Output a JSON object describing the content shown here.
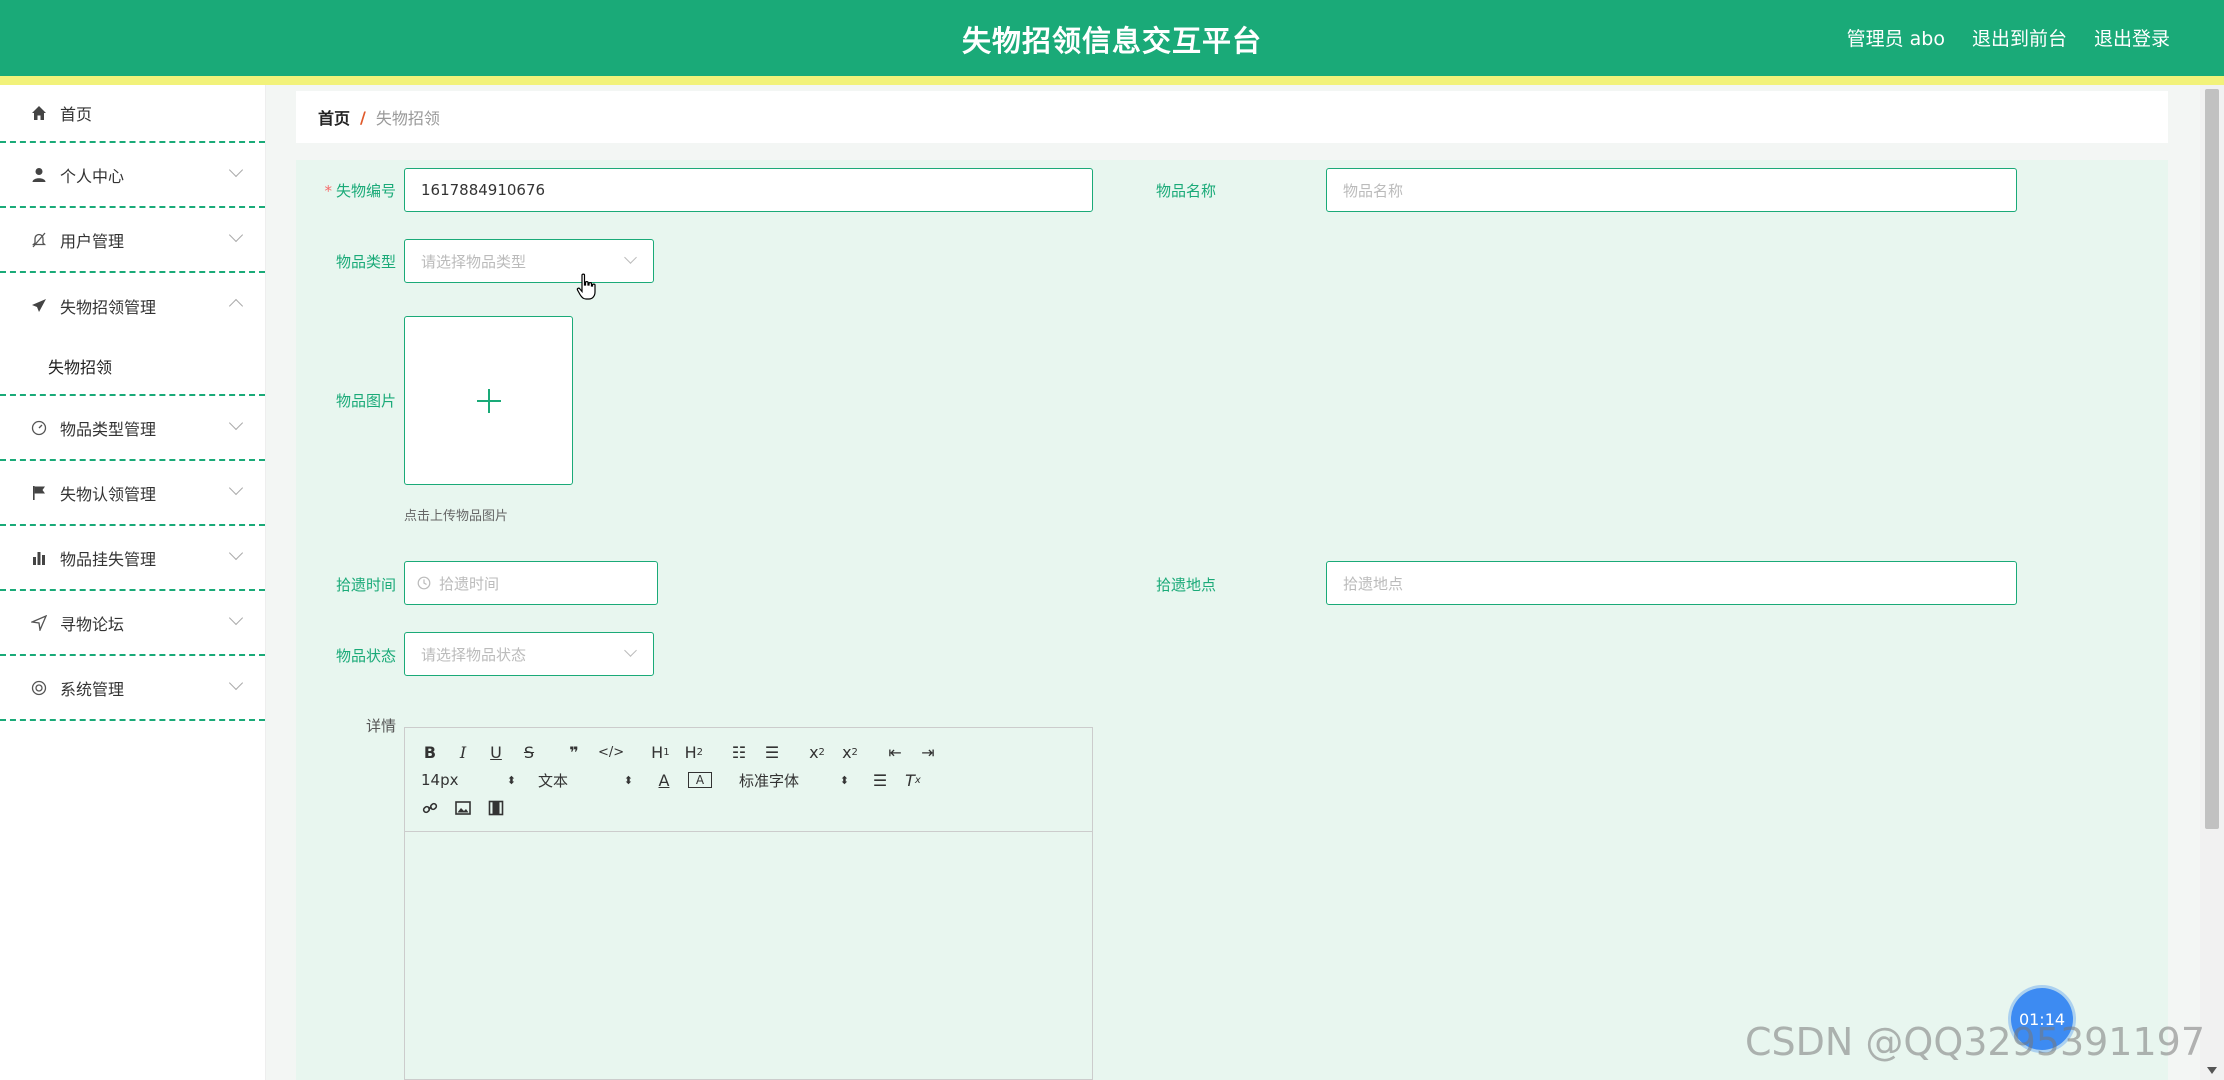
{
  "header": {
    "title": "失物招领信息交互平台",
    "admin_label": "管理员 abo",
    "to_front_label": "退出到前台",
    "logout_label": "退出登录"
  },
  "sidebar": {
    "items": [
      {
        "label": "首页",
        "icon": "home-icon"
      },
      {
        "label": "个人中心",
        "icon": "user-icon"
      },
      {
        "label": "用户管理",
        "icon": "bell-off-icon"
      },
      {
        "label": "失物招领管理",
        "icon": "send-icon",
        "sub": [
          "失物招领"
        ]
      },
      {
        "label": "物品类型管理",
        "icon": "gauge-icon"
      },
      {
        "label": "失物认领管理",
        "icon": "flag-icon"
      },
      {
        "label": "物品挂失管理",
        "icon": "bar-chart-icon"
      },
      {
        "label": "寻物论坛",
        "icon": "navigation-icon"
      },
      {
        "label": "系统管理",
        "icon": "lifebuoy-icon"
      }
    ]
  },
  "breadcrumb": {
    "home": "首页",
    "separator": "/",
    "current": "失物招领"
  },
  "form": {
    "lost_id": {
      "label": "失物编号",
      "value": "1617884910676"
    },
    "item_name": {
      "label": "物品名称",
      "placeholder": "物品名称"
    },
    "item_type": {
      "label": "物品类型",
      "placeholder": "请选择物品类型"
    },
    "item_image": {
      "label": "物品图片",
      "hint": "点击上传物品图片"
    },
    "found_time": {
      "label": "拾遗时间",
      "placeholder": "拾遗时间"
    },
    "found_place": {
      "label": "拾遗地点",
      "placeholder": "拾遗地点"
    },
    "item_status": {
      "label": "物品状态",
      "placeholder": "请选择物品状态"
    },
    "details": {
      "label": "详情"
    }
  },
  "editor": {
    "font_size": "14px",
    "header_picker": "文本",
    "font_family": "标准字体"
  },
  "overlay": {
    "timer": "01:14",
    "watermark": "CSDN @QQ3295391197"
  },
  "colors": {
    "primary": "#1aaa78",
    "accent_bar": "#f2f27a",
    "form_bg": "#e8f6ef"
  }
}
